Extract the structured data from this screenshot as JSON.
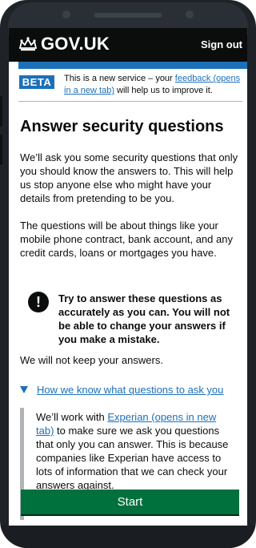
{
  "header": {
    "site_title": "GOV.UK",
    "sign_out_label": "Sign out",
    "crown_icon": "crown-icon"
  },
  "beta_banner": {
    "tag": "BETA",
    "text_before": "This is a new service – your ",
    "link_text": "feedback (opens in a new tab)",
    "text_after": " will help us to improve it."
  },
  "page": {
    "title": "Answer security questions",
    "para1": "We’ll ask you some security questions that only you should know the answers to. This will help us stop anyone else who might have your details from pretending to be you.",
    "para2": "The questions will be about things like your mobile phone contract, bank account, and any credit cards, loans or mortgages you have.",
    "warning": "Try to answer these questions as accurately as you can. You will not be able to change your answers if you make a mistake.",
    "warning_icon": "!",
    "para3": "We will not keep your answers."
  },
  "details": {
    "summary": "How we know what questions to ask you",
    "text_before": "We’ll work with ",
    "link_text": "Experian (opens in new tab)",
    "text_after": " to make sure we ask you questions that only you can answer. This is because companies like Experian have access to lots of information that we can check your answers against."
  },
  "actions": {
    "start_label": "Start"
  },
  "colors": {
    "header_bg": "#0b0c0c",
    "brand_blue": "#1d70b8",
    "start_green": "#00703c"
  }
}
